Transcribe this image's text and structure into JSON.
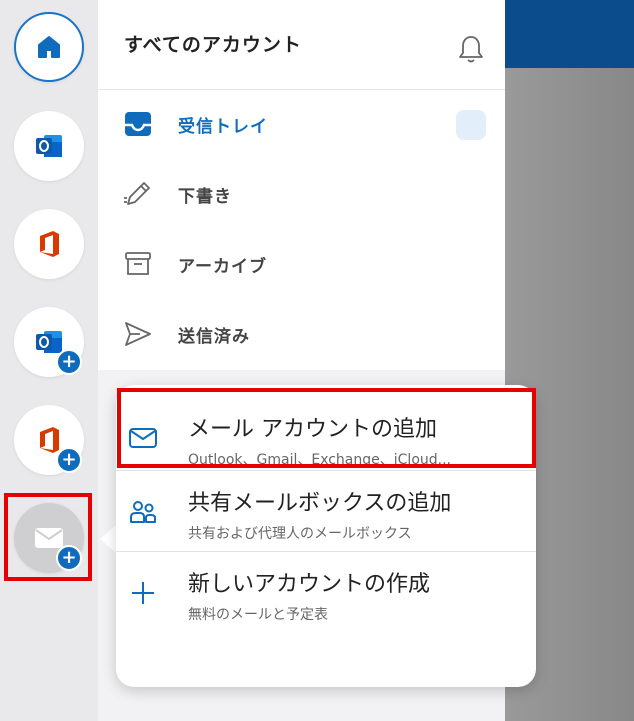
{
  "header": {
    "title": "すべてのアカウント"
  },
  "folders": [
    {
      "label": "受信トレイ",
      "icon": "inbox-icon",
      "active": true
    },
    {
      "label": "下書き",
      "icon": "pencil-icon"
    },
    {
      "label": "アーカイブ",
      "icon": "archive-icon"
    },
    {
      "label": "送信済み",
      "icon": "send-icon"
    }
  ],
  "rail": [
    {
      "icon": "home-icon"
    },
    {
      "icon": "outlook-icon"
    },
    {
      "icon": "office-icon"
    },
    {
      "icon": "outlook-add-icon"
    },
    {
      "icon": "office-add-icon"
    },
    {
      "icon": "mail-add-icon"
    }
  ],
  "menu": {
    "items": [
      {
        "title": "メール アカウントの追加",
        "subtitle": "Outlook、Gmail、Exchange、iCloud...",
        "icon": "envelope-icon"
      },
      {
        "title": "共有メールボックスの追加",
        "subtitle": "共有および代理人のメールボックス",
        "icon": "people-icon"
      },
      {
        "title": "新しいアカウントの作成",
        "subtitle": "無料のメールと予定表",
        "icon": "plus-icon"
      }
    ]
  },
  "colors": {
    "accent": "#0f6cbd",
    "highlight": "#e60000",
    "office_red": "#d83b01"
  }
}
